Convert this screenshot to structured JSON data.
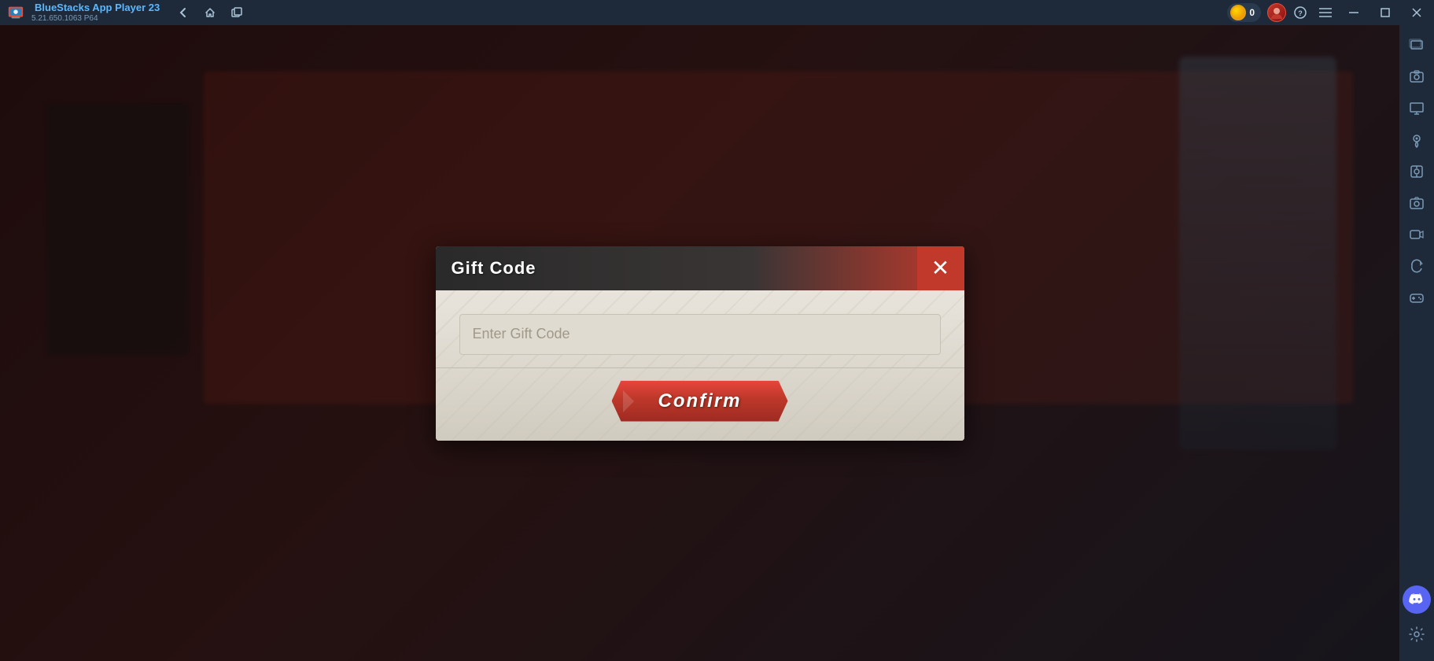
{
  "titlebar": {
    "app_name": "BlueStacks App Player 23",
    "version": "5.21.650.1063  P64",
    "coin_count": "0",
    "nav": {
      "back_label": "←",
      "home_label": "⌂",
      "copy_label": "❐"
    },
    "window_controls": {
      "minimize_label": "—",
      "maximize_label": "□",
      "close_label": "✕"
    },
    "icons": {
      "help": "?",
      "menu": "☰"
    }
  },
  "sidebar": {
    "icons": [
      {
        "name": "layers-icon",
        "symbol": "⊞"
      },
      {
        "name": "screenshot-icon",
        "symbol": "⊡"
      },
      {
        "name": "settings2-icon",
        "symbol": "☰"
      },
      {
        "name": "location-icon",
        "symbol": "⊙"
      },
      {
        "name": "robot-icon",
        "symbol": "⚙"
      },
      {
        "name": "camera-icon",
        "symbol": "◉"
      },
      {
        "name": "macro-icon",
        "symbol": "⏺"
      },
      {
        "name": "rotate-icon",
        "symbol": "↻"
      },
      {
        "name": "gamepad-icon",
        "symbol": "⊡"
      }
    ],
    "discord_label": "D",
    "settings_label": "⚙"
  },
  "modal": {
    "title": "Gift Code",
    "close_label": "✕",
    "input_placeholder": "Enter Gift Code",
    "confirm_label": "Confirm"
  }
}
